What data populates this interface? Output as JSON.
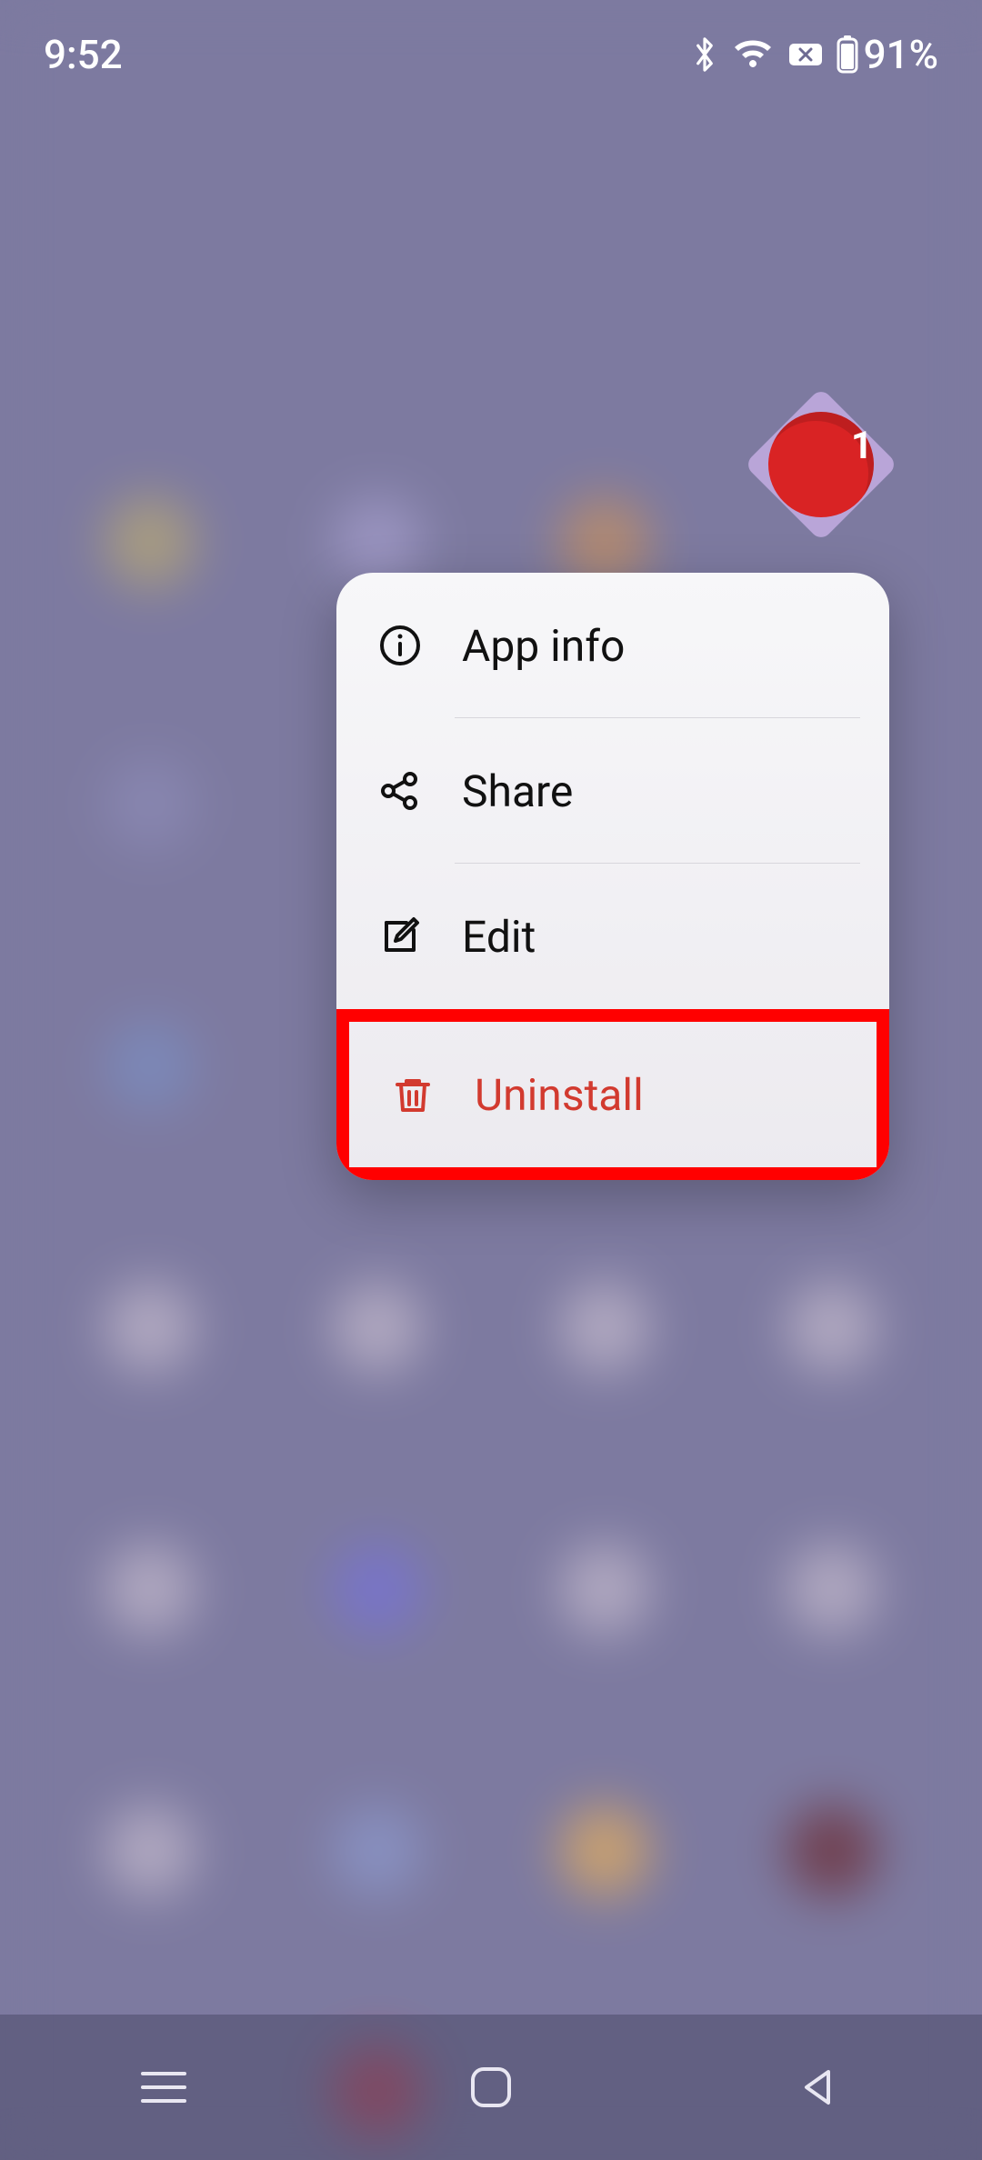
{
  "status": {
    "time": "9:52",
    "battery_percent": "91%"
  },
  "app_icon": {
    "badge_count": "1"
  },
  "menu": {
    "items": [
      {
        "label": "App info",
        "icon": "info-icon"
      },
      {
        "label": "Share",
        "icon": "share-icon"
      },
      {
        "label": "Edit",
        "icon": "edit-icon"
      },
      {
        "label": "Uninstall",
        "icon": "trash-icon",
        "danger": true,
        "highlighted": true
      }
    ]
  }
}
